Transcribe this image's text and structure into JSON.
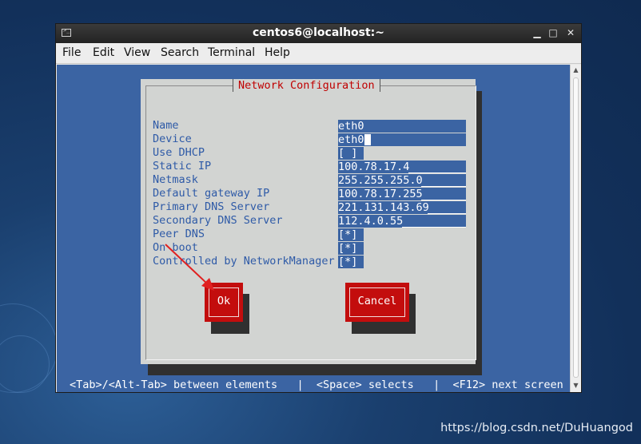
{
  "window": {
    "title": "centos6@localhost:~",
    "controls": {
      "minimize": "▁",
      "maximize": "□",
      "close": "✕"
    }
  },
  "menubar": [
    "File",
    "Edit",
    "View",
    "Search",
    "Terminal",
    "Help"
  ],
  "dialog": {
    "title": "Network Configuration",
    "fields": [
      {
        "label": "Name",
        "value": "eth0"
      },
      {
        "label": "Device",
        "value": "eth0"
      },
      {
        "label": "Use DHCP",
        "value": "[ ]"
      },
      {
        "label": "Static IP",
        "value": "100.78.17.4"
      },
      {
        "label": "Netmask",
        "value": "255.255.255.0"
      },
      {
        "label": "Default gateway IP",
        "value": "100.78.17.255"
      },
      {
        "label": "Primary DNS Server",
        "value": "221.131.143.69"
      },
      {
        "label": "Secondary DNS Server",
        "value": "112.4.0.55"
      },
      {
        "label": "Peer DNS",
        "value": "[*]"
      },
      {
        "label": "On boot",
        "value": "[*]"
      },
      {
        "label": "Controlled by NetworkManager",
        "value": "[*]"
      }
    ],
    "ok_label": "Ok",
    "cancel_label": "Cancel"
  },
  "hint": "<Tab>/<Alt-Tab> between elements   |  <Space> selects   |  <F12> next screen",
  "watermark": "https://blog.csdn.net/DuHuangod",
  "colors": {
    "terminal_bg": "#3b64a3",
    "dialog_bg": "#d2d4d2",
    "label_color": "#2e5aa7",
    "title_color": "#c00000",
    "button_bg": "#c30d0d",
    "annotation_arrow": "#e02020"
  }
}
